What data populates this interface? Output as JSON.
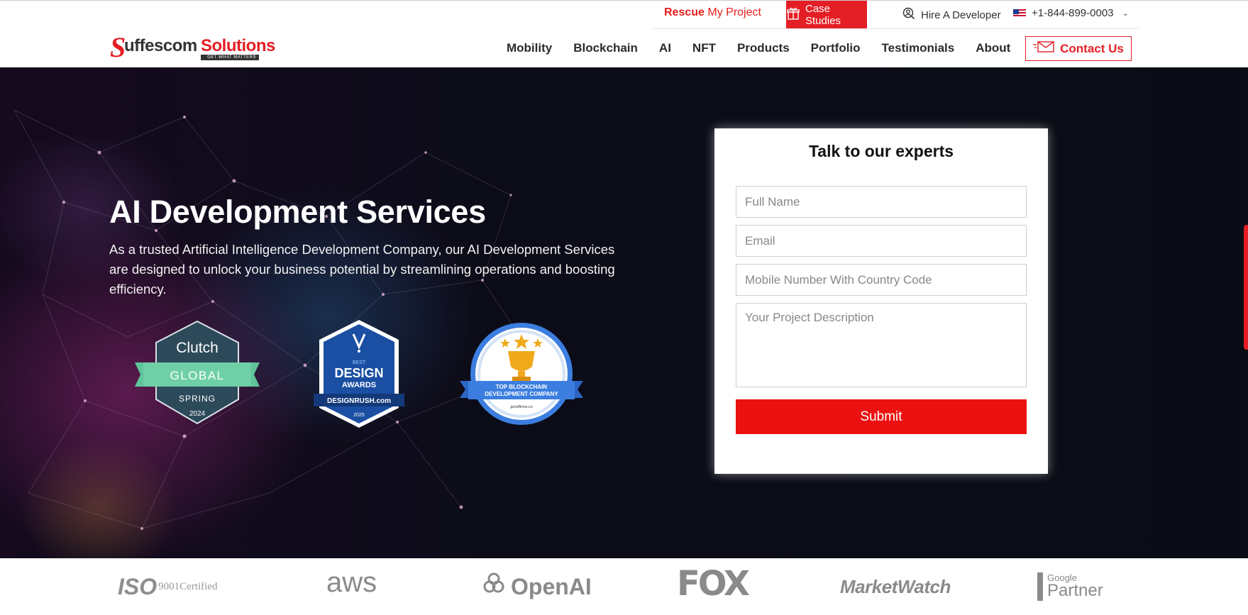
{
  "topbar": {
    "rescue_a": "Rescue",
    "rescue_b": "My Project",
    "case_studies": "Case Studies",
    "hire": "Hire A Developer",
    "phone": "+1-844-899-0003"
  },
  "logo": {
    "word1": "uffescom",
    "word2": "Solutions",
    "initial": "S",
    "tagline": "GET WHAT MATTERS"
  },
  "nav": {
    "items": [
      "Mobility",
      "Blockchain",
      "AI",
      "NFT",
      "Products",
      "Portfolio",
      "Testimonials",
      "About"
    ],
    "contact": "Contact Us"
  },
  "hero": {
    "title": "AI Development Services",
    "lead": "As a trusted Artificial Intelligence Development Company, our AI Development Services are designed to unlock your business potential by streamlining operations and boosting efficiency."
  },
  "badges": {
    "clutch": {
      "name": "Clutch",
      "ribbon": "GLOBAL",
      "season": "SPRING",
      "year": "2024"
    },
    "design": {
      "top": "BEST",
      "main": "DESIGN",
      "sub": "AWARDS",
      "ribbon": "DESIGNRUSH.com",
      "year": "2025"
    },
    "goodfirms": {
      "line1": "TOP BLOCKCHAIN",
      "line2": "DEVELOPMENT COMPANY",
      "site": "goodfirms.co"
    }
  },
  "form": {
    "heading": "Talk to our experts",
    "full_name": "Full Name",
    "email": "Email",
    "mobile": "Mobile Number With Country Code",
    "description": "Your Project Description",
    "submit": "Submit"
  },
  "clients": {
    "iso": "ISO",
    "iso_cert": "9001Certified",
    "aws": "aws",
    "openai": "OpenAI",
    "fox": "FOX",
    "marketwatch": "MarketWatch",
    "google": "Google",
    "partner": "Partner"
  },
  "colors": {
    "brand_red": "#e41e25",
    "submit_red": "#ec1111",
    "hero_bg": "#0b0c18"
  }
}
